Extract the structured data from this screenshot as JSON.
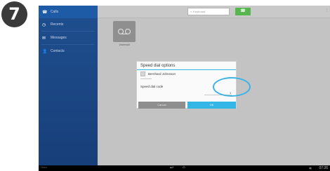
{
  "step": {
    "number": "7"
  },
  "sidebar": {
    "items": [
      {
        "icon": "phone-icon",
        "glyph": "☎",
        "label": "Calls",
        "active": true
      },
      {
        "icon": "clock-icon",
        "glyph": "◷",
        "label": "Recents",
        "active": false
      },
      {
        "icon": "message-icon",
        "glyph": "✉",
        "label": "Messages",
        "active": false
      },
      {
        "icon": "contacts-icon",
        "glyph": "👤",
        "label": "Contacts",
        "active": false
      }
    ]
  },
  "topbar": {
    "search_placeholder": "Keyboard",
    "call_glyph": "☎"
  },
  "voicemail": {
    "label": "Voicemail"
  },
  "dialog": {
    "title": "Speed dial options",
    "contact_name": "Bernhard Johnsson",
    "code_label": "Speed dial code",
    "code_value": "1",
    "cancel_label": "Cancel",
    "ok_label": "OK"
  },
  "navbar": {
    "left_text": "Cisco",
    "back_glyph": "↩",
    "home_glyph": "⌂",
    "volume_glyph": "◀)",
    "time": "07:26"
  },
  "colors": {
    "accent": "#33b5e5",
    "sidebar": "#1f4f8f",
    "call_green": "#58b64f",
    "highlight": "#3bb3e6"
  }
}
